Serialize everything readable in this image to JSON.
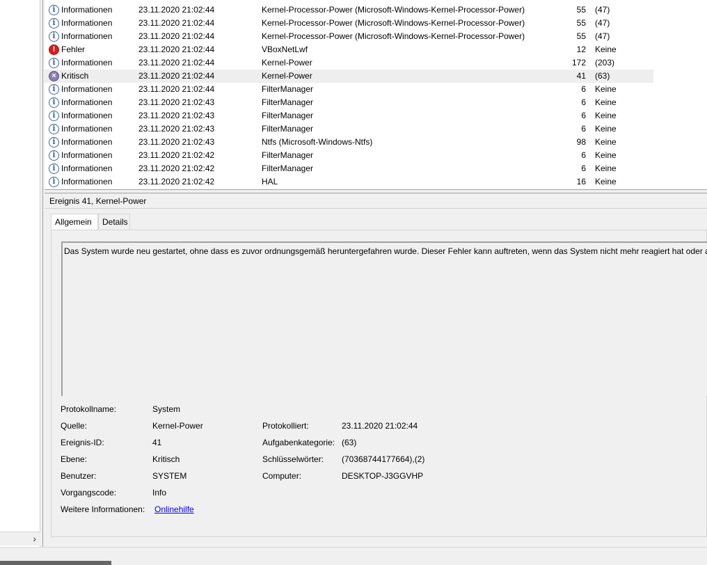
{
  "events": [
    {
      "level": "Informationen",
      "icon": "info-icon",
      "datetime": "23.11.2020 21:02:44",
      "source": "Kernel-Processor-Power (Microsoft-Windows-Kernel-Processor-Power)",
      "event_id": "55",
      "category": "(47)"
    },
    {
      "level": "Informationen",
      "icon": "info-icon",
      "datetime": "23.11.2020 21:02:44",
      "source": "Kernel-Processor-Power (Microsoft-Windows-Kernel-Processor-Power)",
      "event_id": "55",
      "category": "(47)"
    },
    {
      "level": "Informationen",
      "icon": "info-icon",
      "datetime": "23.11.2020 21:02:44",
      "source": "Kernel-Processor-Power (Microsoft-Windows-Kernel-Processor-Power)",
      "event_id": "55",
      "category": "(47)"
    },
    {
      "level": "Fehler",
      "icon": "error-icon",
      "datetime": "23.11.2020 21:02:44",
      "source": "VBoxNetLwf",
      "event_id": "12",
      "category": "Keine"
    },
    {
      "level": "Informationen",
      "icon": "info-icon",
      "datetime": "23.11.2020 21:02:44",
      "source": "Kernel-Power",
      "event_id": "172",
      "category": "(203)"
    },
    {
      "level": "Kritisch",
      "icon": "critical-icon",
      "datetime": "23.11.2020 21:02:44",
      "source": "Kernel-Power",
      "event_id": "41",
      "category": "(63)"
    },
    {
      "level": "Informationen",
      "icon": "info-icon",
      "datetime": "23.11.2020 21:02:44",
      "source": "FilterManager",
      "event_id": "6",
      "category": "Keine"
    },
    {
      "level": "Informationen",
      "icon": "info-icon",
      "datetime": "23.11.2020 21:02:43",
      "source": "FilterManager",
      "event_id": "6",
      "category": "Keine"
    },
    {
      "level": "Informationen",
      "icon": "info-icon",
      "datetime": "23.11.2020 21:02:43",
      "source": "FilterManager",
      "event_id": "6",
      "category": "Keine"
    },
    {
      "level": "Informationen",
      "icon": "info-icon",
      "datetime": "23.11.2020 21:02:43",
      "source": "FilterManager",
      "event_id": "6",
      "category": "Keine"
    },
    {
      "level": "Informationen",
      "icon": "info-icon",
      "datetime": "23.11.2020 21:02:43",
      "source": "Ntfs (Microsoft-Windows-Ntfs)",
      "event_id": "98",
      "category": "Keine"
    },
    {
      "level": "Informationen",
      "icon": "info-icon",
      "datetime": "23.11.2020 21:02:42",
      "source": "FilterManager",
      "event_id": "6",
      "category": "Keine"
    },
    {
      "level": "Informationen",
      "icon": "info-icon",
      "datetime": "23.11.2020 21:02:42",
      "source": "FilterManager",
      "event_id": "6",
      "category": "Keine"
    },
    {
      "level": "Informationen",
      "icon": "info-icon",
      "datetime": "23.11.2020 21:02:42",
      "source": "HAL",
      "event_id": "16",
      "category": "Keine"
    }
  ],
  "selected_index": 5,
  "details": {
    "header": "Ereignis 41, Kernel-Power",
    "tabs": [
      "Allgemein",
      "Details"
    ],
    "description": "Das System wurde neu gestartet, ohne dass es zuvor ordnungsgemäß heruntergefahren wurde. Dieser Fehler kann auftreten, wenn das System nicht mehr reagiert hat oder abge",
    "labels": {
      "log_name": "Protokollname:",
      "source": "Quelle:",
      "event_id": "Ereignis-ID:",
      "level": "Ebene:",
      "user": "Benutzer:",
      "opcode": "Vorgangscode:",
      "more_info": "Weitere Informationen:",
      "logged": "Protokolliert:",
      "task_category": "Aufgabenkategorie:",
      "keywords": "Schlüsselwörter:",
      "computer": "Computer:"
    },
    "values": {
      "log_name": "System",
      "source": "Kernel-Power",
      "event_id": "41",
      "level": "Kritisch",
      "user": "SYSTEM",
      "opcode": "Info",
      "more_info_link": "Onlinehilfe",
      "logged": "23.11.2020 21:02:44",
      "task_category": "(63)",
      "keywords": "(70368744177664),(2)",
      "computer": "DESKTOP-J3GGVHP"
    }
  },
  "left_pane": {
    "scroll_arrow": "›"
  }
}
